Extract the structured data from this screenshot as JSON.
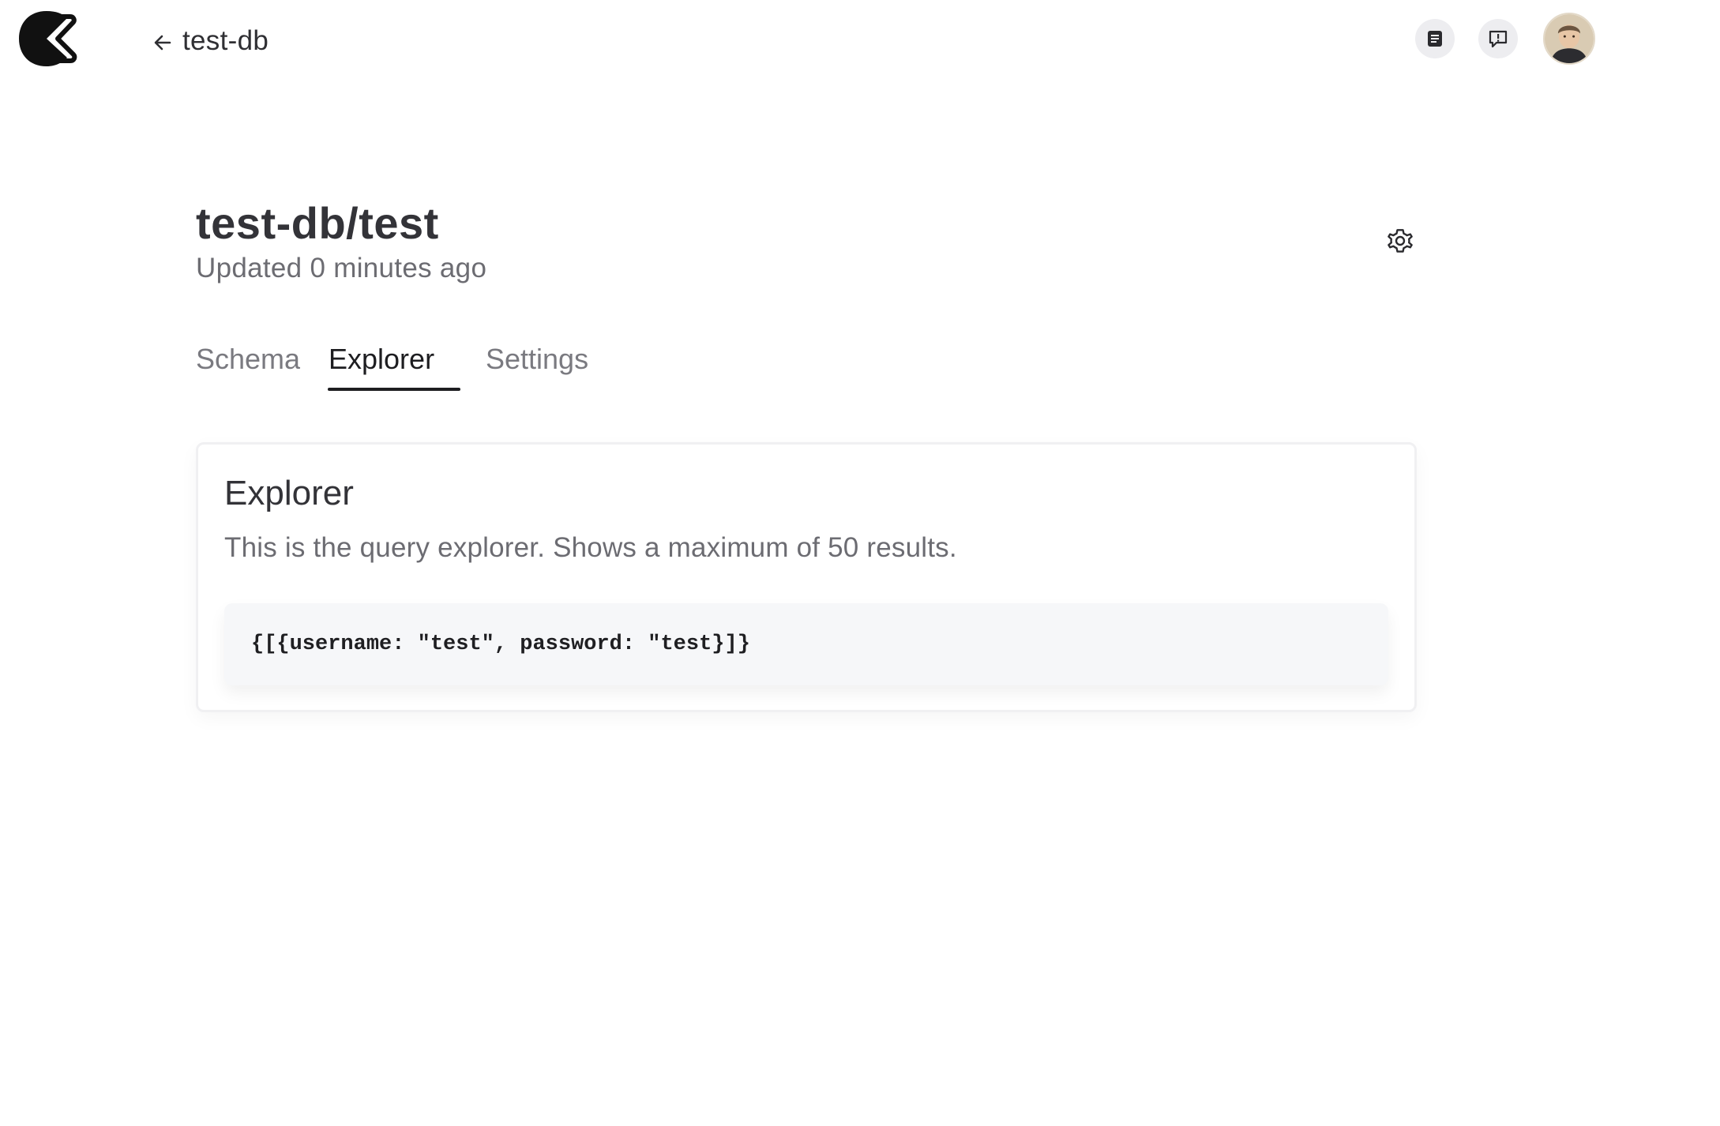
{
  "header": {
    "back_label": "test-db",
    "icons": [
      "logo-icon",
      "back-arrow-icon",
      "docs-icon",
      "feedback-icon",
      "avatar"
    ]
  },
  "page": {
    "title": "test-db/test",
    "subtitle": "Updated 0 minutes ago"
  },
  "tabs": [
    {
      "label": "Schema",
      "active": false
    },
    {
      "label": "Explorer",
      "active": true
    },
    {
      "label": "Settings",
      "active": false
    }
  ],
  "explorer": {
    "title": "Explorer",
    "description": "This is the query explorer. Shows a maximum of 50 results.",
    "result": "{[{username: \"test\", password: \"test}]}"
  },
  "colors": {
    "text_primary": "#333338",
    "text_secondary": "#6c6c72",
    "active_tab_underline": "#1d1d20",
    "icon_button_bg": "#ededf0",
    "code_bg": "#f6f7f9"
  }
}
